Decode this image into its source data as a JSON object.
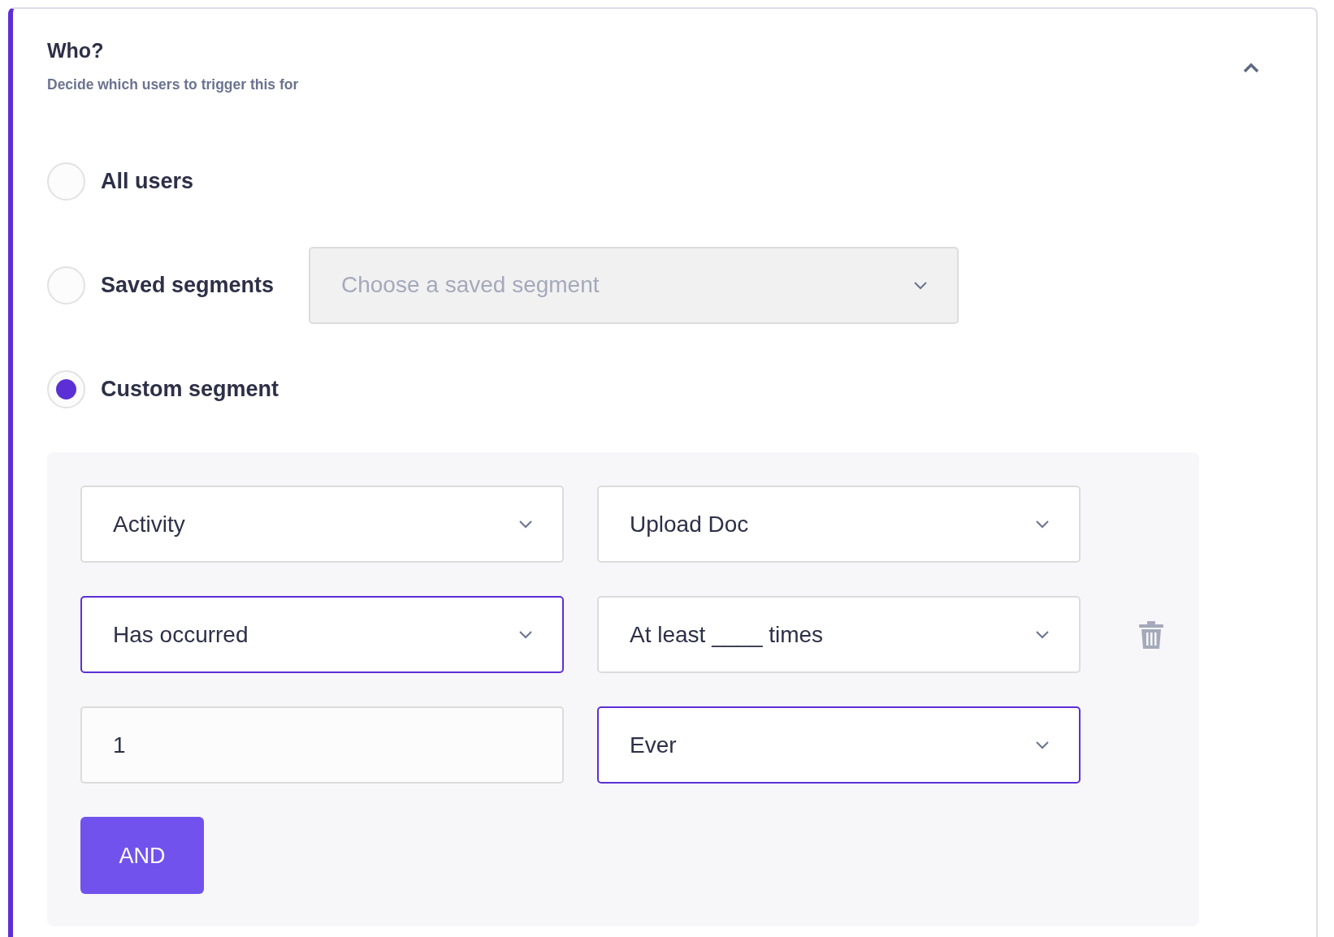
{
  "section": {
    "title": "Who?",
    "subtitle": "Decide which users to trigger this for",
    "expanded": true
  },
  "options": [
    {
      "label": "All users",
      "selected": false
    },
    {
      "label": "Saved segments",
      "selected": false,
      "dropdown": {
        "placeholder": "Choose a saved segment",
        "disabled": true
      }
    },
    {
      "label": "Custom segment",
      "selected": true
    }
  ],
  "custom_segment": {
    "rows": [
      {
        "deletable": false,
        "fields": [
          {
            "kind": "select",
            "value": "Activity",
            "focused": false
          },
          {
            "kind": "select",
            "value": "Upload Doc",
            "focused": false
          }
        ]
      },
      {
        "deletable": true,
        "fields": [
          {
            "kind": "select",
            "value": "Has occurred",
            "focused": true
          },
          {
            "kind": "select",
            "value": "At least ____ times",
            "focused": false
          }
        ]
      },
      {
        "deletable": false,
        "fields": [
          {
            "kind": "input",
            "value": "1",
            "focused": false
          },
          {
            "kind": "select",
            "value": "Ever",
            "focused": true
          }
        ]
      }
    ],
    "and_button": "AND"
  }
}
